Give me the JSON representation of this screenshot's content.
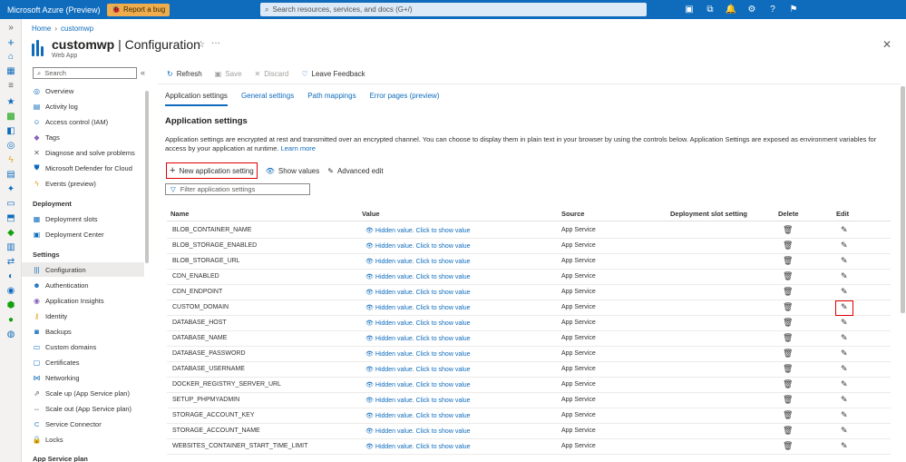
{
  "topbar": {
    "brand": "Microsoft Azure (Preview)",
    "bug_label": "Report a bug",
    "search_placeholder": "Search resources, services, and docs (G+/)"
  },
  "breadcrumb": {
    "home": "Home",
    "resource": "customwp"
  },
  "header": {
    "resource_name": "customwp",
    "page_name": "Configuration",
    "separator": "|",
    "subtitle": "Web App"
  },
  "sidebar": {
    "search_placeholder": "Search",
    "groups": [
      {
        "items": [
          {
            "label": "Overview",
            "icon": "globe-icon"
          },
          {
            "label": "Activity log",
            "icon": "log-icon"
          },
          {
            "label": "Access control (IAM)",
            "icon": "people-icon"
          },
          {
            "label": "Tags",
            "icon": "tag-icon"
          },
          {
            "label": "Diagnose and solve problems",
            "icon": "wrench-icon"
          },
          {
            "label": "Microsoft Defender for Cloud",
            "icon": "shield-icon"
          },
          {
            "label": "Events (preview)",
            "icon": "lightning-icon"
          }
        ]
      },
      {
        "heading": "Deployment",
        "items": [
          {
            "label": "Deployment slots",
            "icon": "slots-icon"
          },
          {
            "label": "Deployment Center",
            "icon": "cube-icon"
          }
        ]
      },
      {
        "heading": "Settings",
        "items": [
          {
            "label": "Configuration",
            "icon": "config-icon",
            "active": true
          },
          {
            "label": "Authentication",
            "icon": "person-icon"
          },
          {
            "label": "Application Insights",
            "icon": "bulb-icon"
          },
          {
            "label": "Identity",
            "icon": "key-icon"
          },
          {
            "label": "Backups",
            "icon": "backup-icon"
          },
          {
            "label": "Custom domains",
            "icon": "www-icon"
          },
          {
            "label": "Certificates",
            "icon": "cert-icon"
          },
          {
            "label": "Networking",
            "icon": "network-icon"
          },
          {
            "label": "Scale up (App Service plan)",
            "icon": "scaleup-icon"
          },
          {
            "label": "Scale out (App Service plan)",
            "icon": "scaleout-icon"
          },
          {
            "label": "Service Connector",
            "icon": "connector-icon"
          },
          {
            "label": "Locks",
            "icon": "lock-icon"
          }
        ]
      },
      {
        "heading": "App Service plan",
        "items": []
      }
    ]
  },
  "toolbar": {
    "refresh": "Refresh",
    "save": "Save",
    "discard": "Discard",
    "feedback": "Leave Feedback"
  },
  "tabs": [
    "Application settings",
    "General settings",
    "Path mappings",
    "Error pages (preview)"
  ],
  "section": {
    "title": "Application settings",
    "description": "Application settings are encrypted at rest and transmitted over an encrypted channel. You can choose to display them in plain text in your browser by using the controls below. Application Settings are exposed as environment variables for access by your application at runtime.",
    "learn_more": "Learn more"
  },
  "actions": {
    "new_setting": "New application setting",
    "show_values": "Show values",
    "advanced_edit": "Advanced edit"
  },
  "filter_placeholder": "Filter application settings",
  "table": {
    "columns": [
      "Name",
      "Value",
      "Source",
      "Deployment slot setting",
      "Delete",
      "Edit"
    ],
    "hidden_value_text": "Hidden value. Click to show value",
    "rows": [
      {
        "name": "BLOB_CONTAINER_NAME",
        "source": "App Service"
      },
      {
        "name": "BLOB_STORAGE_ENABLED",
        "source": "App Service"
      },
      {
        "name": "BLOB_STORAGE_URL",
        "source": "App Service"
      },
      {
        "name": "CDN_ENABLED",
        "source": "App Service"
      },
      {
        "name": "CDN_ENDPOINT",
        "source": "App Service"
      },
      {
        "name": "CUSTOM_DOMAIN",
        "source": "App Service"
      },
      {
        "name": "DATABASE_HOST",
        "source": "App Service"
      },
      {
        "name": "DATABASE_NAME",
        "source": "App Service"
      },
      {
        "name": "DATABASE_PASSWORD",
        "source": "App Service"
      },
      {
        "name": "DATABASE_USERNAME",
        "source": "App Service"
      },
      {
        "name": "DOCKER_REGISTRY_SERVER_URL",
        "source": "App Service"
      },
      {
        "name": "SETUP_PHPMYADMIN",
        "source": "App Service"
      },
      {
        "name": "STORAGE_ACCOUNT_KEY",
        "source": "App Service"
      },
      {
        "name": "STORAGE_ACCOUNT_NAME",
        "source": "App Service"
      },
      {
        "name": "WEBSITES_CONTAINER_START_TIME_LIMIT",
        "source": "App Service"
      }
    ]
  },
  "colors": {
    "brand_blue": "#0f6cbd",
    "highlight_red": "#e00000",
    "bug_orange": "#f0ad4e"
  }
}
